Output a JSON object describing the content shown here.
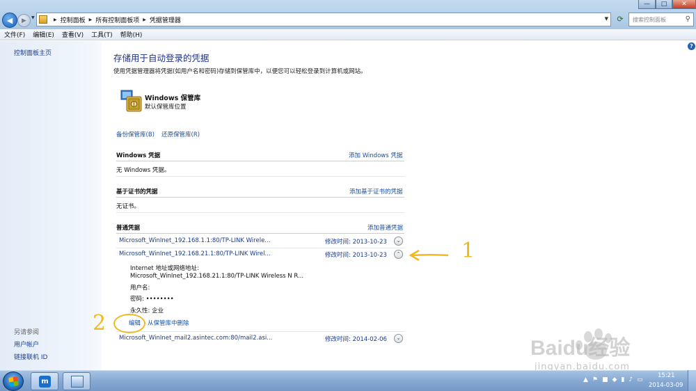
{
  "window": {
    "breadcrumbs": [
      "控制面板",
      "所有控制面板项",
      "凭据管理器"
    ],
    "search_placeholder": "搜索控制面板",
    "min_label": "—",
    "max_label": "□",
    "close_label": "✕"
  },
  "menu": [
    "文件(F)",
    "编辑(E)",
    "查看(V)",
    "工具(T)",
    "帮助(H)"
  ],
  "sidebar": {
    "home": "控制面板主页",
    "see_also": "另请参阅",
    "links": [
      "用户帐户",
      "链接联机 ID"
    ]
  },
  "main": {
    "title": "存储用于自动登录的凭据",
    "description": "使用凭据管理器将凭据(如用户名和密码)存储到保管库中，以便您可以轻松登录到计算机或网站。",
    "vault": {
      "title": "Windows 保管库",
      "subtitle": "默认保管库位置"
    },
    "backup_link": "备份保管库(B)",
    "restore_link": "还原保管库(R)",
    "windows_section": {
      "title": "Windows 凭据",
      "add": "添加 Windows 凭据",
      "empty": "无 Windows 凭据。"
    },
    "cert_section": {
      "title": "基于证书的凭据",
      "add": "添加基于证书的凭据",
      "empty": "无证书。"
    },
    "generic_section": {
      "title": "普通凭据",
      "add": "添加普通凭据"
    },
    "credentials": [
      {
        "name": "Microsoft_WinInet_192.168.1.1:80/TP-LINK Wirele...",
        "modified": "修改时间:  2013-10-23",
        "chevron": "⌄"
      },
      {
        "name": "Microsoft_WinInet_192.168.21.1:80/TP-LINK Wirel...",
        "modified": "修改时间:  2013-10-23",
        "chevron": "⌃"
      },
      {
        "name": "Microsoft_WinInet_mail2.asintec.com:80/mail2.asi...",
        "modified": "修改时间:  2014-02-06",
        "chevron": "⌄"
      }
    ],
    "expanded": {
      "address_label": "Internet 地址或网络地址:",
      "address_value": "Microsoft_WinInet_192.168.21.1:80/TP-LINK Wireless N R...",
      "username_label": "用户名:",
      "password": "密码:  ••••••••",
      "persistence": "永久性:  企业",
      "edit": "编辑",
      "delete": "从保管库中删除"
    },
    "help": "?"
  },
  "annotations": {
    "one": "1",
    "two": "2"
  },
  "watermark": {
    "brand": "Baidu经验",
    "url": "jingyan.baidu.com"
  },
  "taskbar": {
    "time": "15:21",
    "date": "2014-03-09"
  },
  "colors": {
    "link": "#1a4fa5",
    "title": "#1e3287",
    "annotation": "#f2b91d"
  }
}
